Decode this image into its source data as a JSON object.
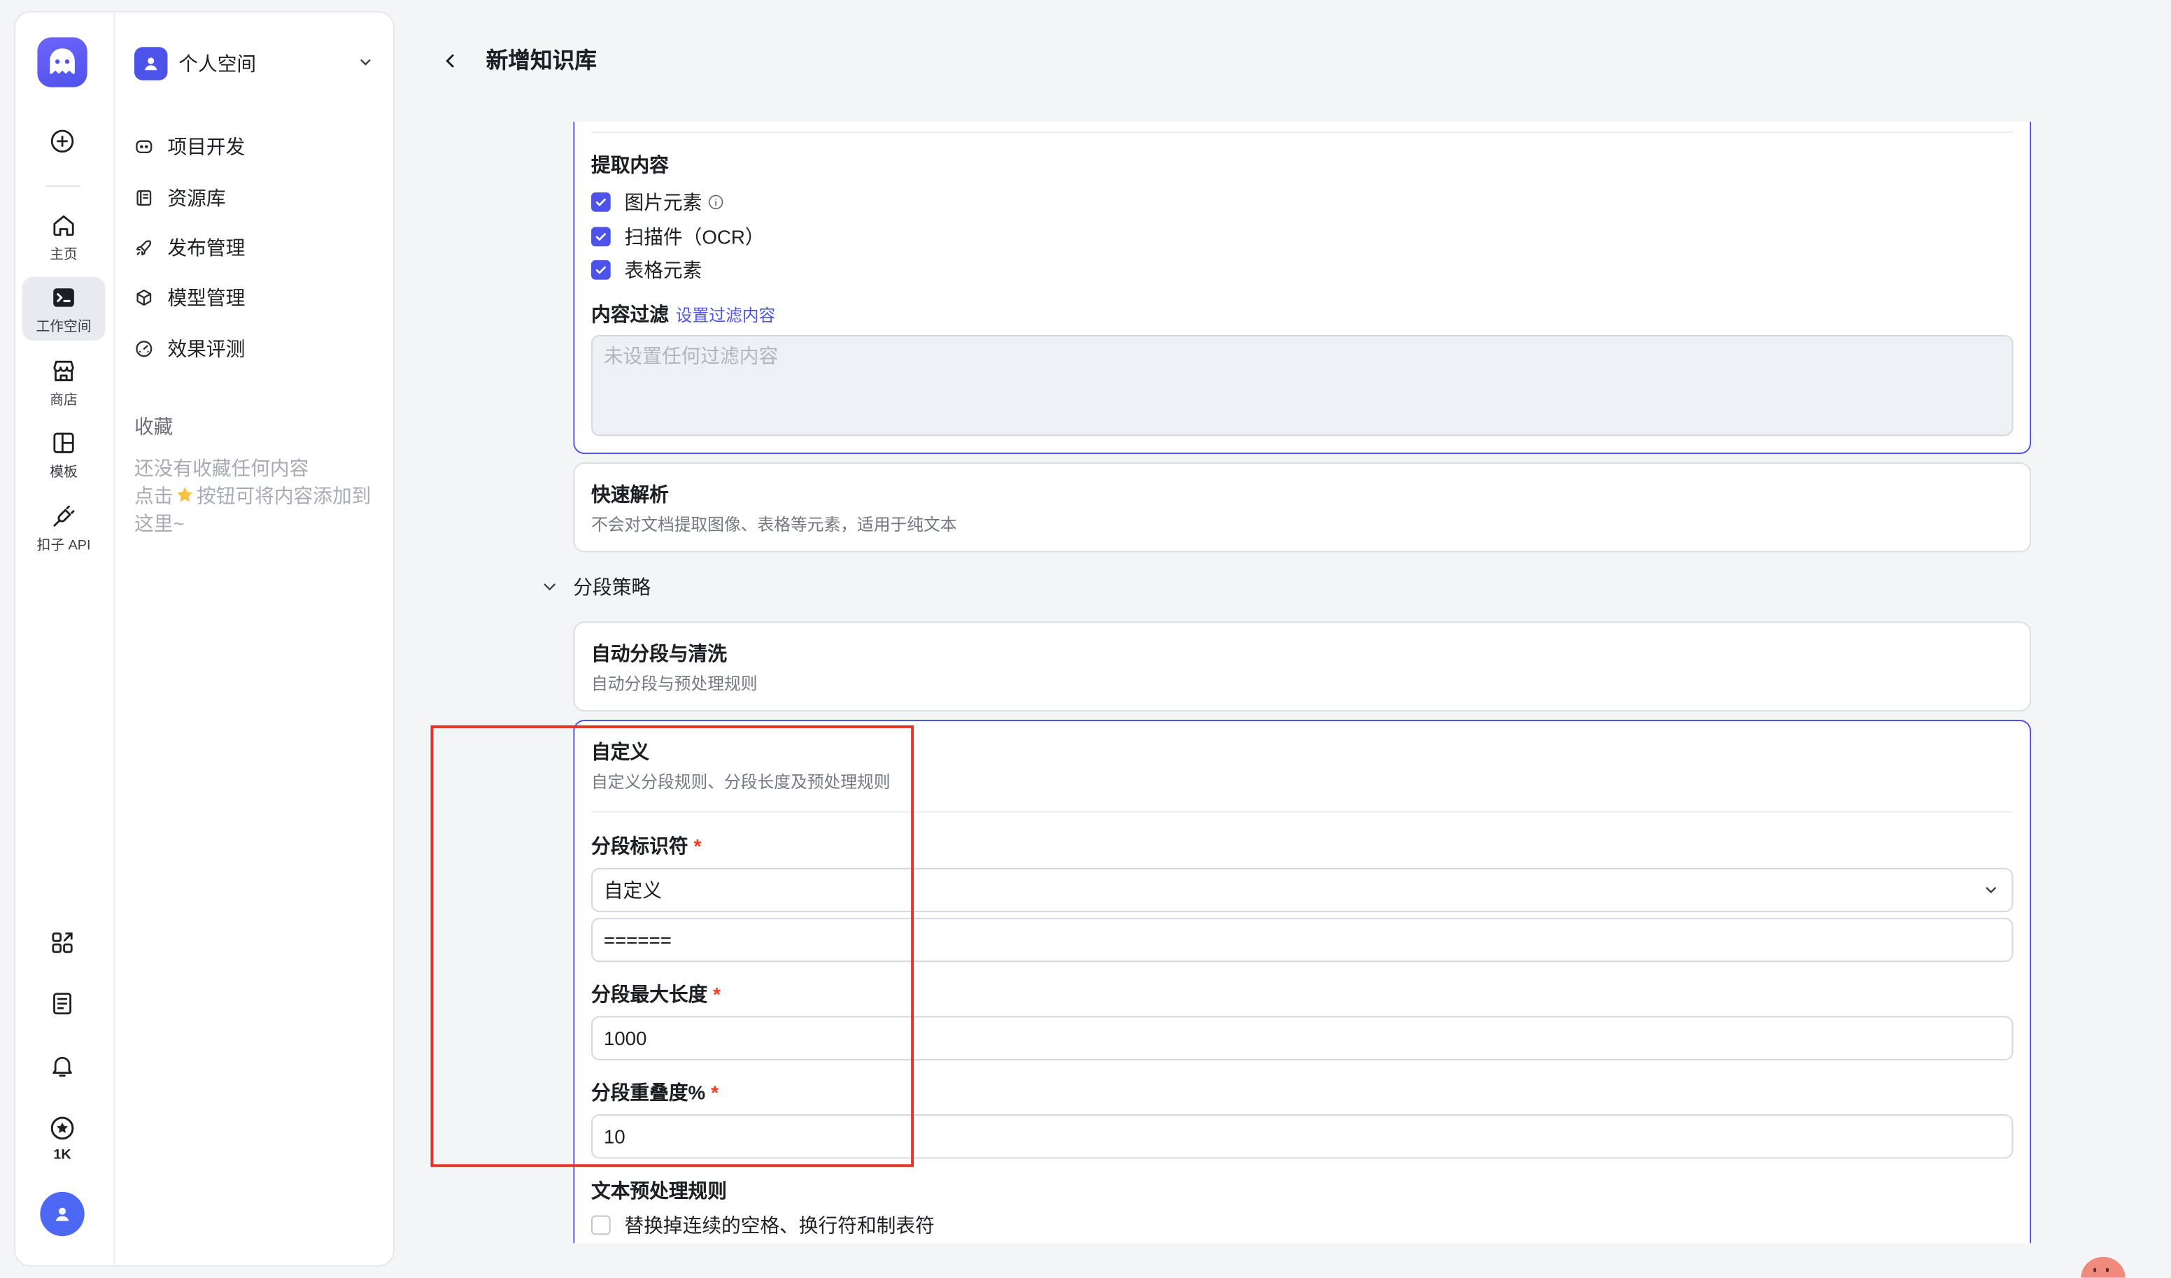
{
  "rail": {
    "items": [
      {
        "label": "主页",
        "icon": "home-icon"
      },
      {
        "label": "工作空间",
        "icon": "terminal-icon"
      },
      {
        "label": "商店",
        "icon": "store-icon"
      },
      {
        "label": "模板",
        "icon": "template-icon"
      },
      {
        "label": "扣子 API",
        "icon": "api-plug-icon"
      }
    ],
    "credits_label": "1K"
  },
  "workspace": {
    "name": "个人空间"
  },
  "nav": {
    "items": [
      {
        "label": "项目开发",
        "icon": "robot-icon"
      },
      {
        "label": "资源库",
        "icon": "library-icon"
      },
      {
        "label": "发布管理",
        "icon": "rocket-icon"
      },
      {
        "label": "模型管理",
        "icon": "cube-icon"
      },
      {
        "label": "效果评测",
        "icon": "gauge-icon"
      }
    ]
  },
  "favorites": {
    "title": "收藏",
    "empty_line1": "还没有收藏任何内容",
    "hint_prefix": "点击",
    "hint_suffix": "按钮可将内容添加到这里~"
  },
  "header": {
    "title": "新增知识库"
  },
  "parsing": {
    "precise": {
      "extract_title": "提取内容",
      "options": [
        {
          "label": "图片元素",
          "checked": true
        },
        {
          "label": "扫描件（OCR）",
          "checked": true
        },
        {
          "label": "表格元素",
          "checked": true
        }
      ],
      "filter_title": "内容过滤",
      "filter_link": "设置过滤内容",
      "filter_placeholder": "未设置任何过滤内容"
    },
    "fast": {
      "title": "快速解析",
      "desc": "不会对文档提取图像、表格等元素，适用于纯文本"
    }
  },
  "segmentation": {
    "section_title": "分段策略",
    "required_mark": "*",
    "auto": {
      "title": "自动分段与清洗",
      "desc": "自动分段与预处理规则"
    },
    "custom": {
      "title": "自定义",
      "desc": "自定义分段规则、分段长度及预处理规则",
      "separator_label": "分段标识符",
      "separator_select": "自定义",
      "separator_value": "======",
      "max_length_label": "分段最大长度",
      "max_length_value": "1000",
      "overlap_label": "分段重叠度%",
      "overlap_value": "10",
      "preprocess_title": "文本预处理规则",
      "preprocess_rules": [
        {
          "label": "替换掉连续的空格、换行符和制表符",
          "checked": false
        }
      ]
    }
  },
  "colors": {
    "primary": "#4d53e8",
    "required": "#f93920",
    "annotation": "#e5332a",
    "avatar": "#4d68f2"
  }
}
